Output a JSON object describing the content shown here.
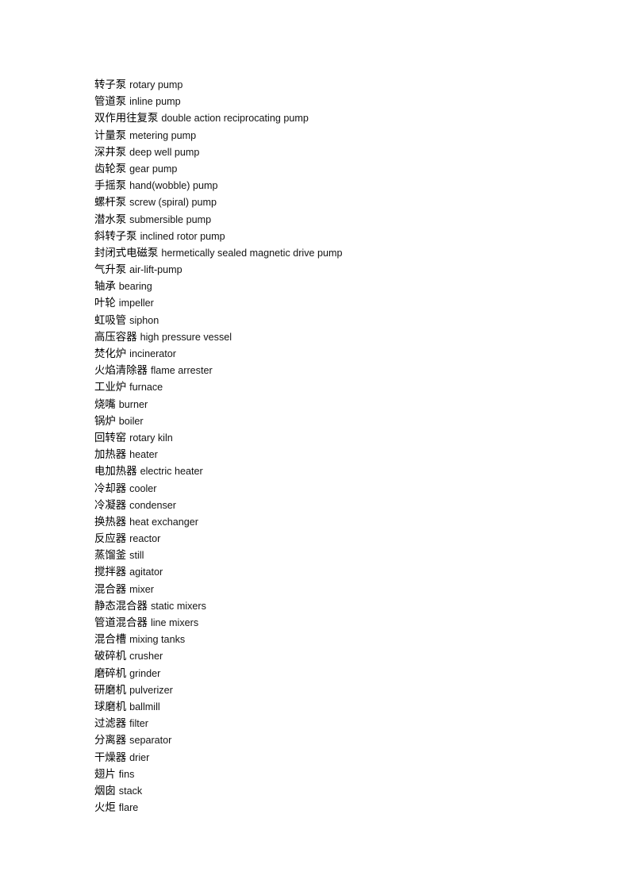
{
  "document": {
    "background_color": "#ffffff",
    "text_color": "#000000",
    "glossary": {
      "entries": [
        {
          "zh": "转子泵",
          "en": "rotary pump"
        },
        {
          "zh": "管道泵",
          "en": "inline pump"
        },
        {
          "zh": "双作用往复泵",
          "en": "double action reciprocating pump"
        },
        {
          "zh": "计量泵",
          "en": "metering pump"
        },
        {
          "zh": "深井泵",
          "en": "deep well pump"
        },
        {
          "zh": "齿轮泵",
          "en": "gear pump"
        },
        {
          "zh": "手摇泵",
          "en": "hand(wobble) pump"
        },
        {
          "zh": "螺杆泵",
          "en": "screw (spiral) pump"
        },
        {
          "zh": "潜水泵",
          "en": "submersible pump"
        },
        {
          "zh": "斜转子泵",
          "en": "inclined rotor pump"
        },
        {
          "zh": "封闭式电磁泵",
          "en": "hermetically sealed magnetic drive pump"
        },
        {
          "zh": "气升泵",
          "en": "air-lift-pump"
        },
        {
          "zh": "轴承",
          "en": "bearing"
        },
        {
          "zh": "叶轮",
          "en": "impeller"
        },
        {
          "zh": "虹吸管",
          "en": "siphon"
        },
        {
          "zh": "高压容器",
          "en": "high pressure vessel"
        },
        {
          "zh": "焚化炉",
          "en": "incinerator"
        },
        {
          "zh": "火焰清除器",
          "en": "flame arrester"
        },
        {
          "zh": "工业炉",
          "en": "furnace"
        },
        {
          "zh": "烧嘴",
          "en": "burner"
        },
        {
          "zh": "锅炉",
          "en": "boiler"
        },
        {
          "zh": "回转窑",
          "en": "rotary kiln"
        },
        {
          "zh": "加热器",
          "en": "heater"
        },
        {
          "zh": "电加热器",
          "en": "electric heater"
        },
        {
          "zh": "冷却器",
          "en": "cooler"
        },
        {
          "zh": "冷凝器",
          "en": "condenser"
        },
        {
          "zh": "换热器",
          "en": "heat exchanger"
        },
        {
          "zh": "反应器",
          "en": "reactor"
        },
        {
          "zh": "蒸馏釜",
          "en": "still"
        },
        {
          "zh": "搅拌器",
          "en": "agitator"
        },
        {
          "zh": "混合器",
          "en": "mixer"
        },
        {
          "zh": "静态混合器",
          "en": "static mixers"
        },
        {
          "zh": "管道混合器",
          "en": "line mixers"
        },
        {
          "zh": "混合槽",
          "en": "mixing tanks"
        },
        {
          "zh": "破碎机",
          "en": "crusher"
        },
        {
          "zh": "磨碎机",
          "en": "grinder"
        },
        {
          "zh": "研磨机",
          "en": "pulverizer"
        },
        {
          "zh": "球磨机",
          "en": "ballmill"
        },
        {
          "zh": "过滤器",
          "en": "filter"
        },
        {
          "zh": "分离器",
          "en": "separator"
        },
        {
          "zh": "干燥器",
          "en": "drier"
        },
        {
          "zh": "翅片",
          "en": "fins"
        },
        {
          "zh": "烟囱",
          "en": "stack"
        },
        {
          "zh": "火炬",
          "en": "flare"
        }
      ]
    }
  }
}
